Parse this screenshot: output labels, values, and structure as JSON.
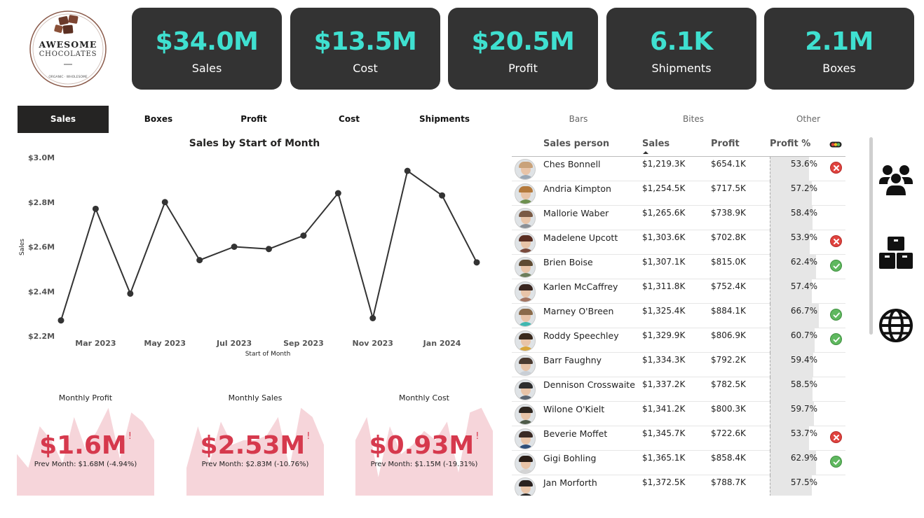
{
  "logo": {
    "line1": "AWESOME",
    "line2": "CHOCOLATES",
    "ring_text": "ORGANIC · WHOLESOME"
  },
  "kpis": [
    {
      "value": "$34.0M",
      "label": "Sales"
    },
    {
      "value": "$13.5M",
      "label": "Cost"
    },
    {
      "value": "$20.5M",
      "label": "Profit"
    },
    {
      "value": "6.1K",
      "label": "Shipments"
    },
    {
      "value": "2.1M",
      "label": "Boxes"
    }
  ],
  "metric_tabs": [
    "Sales",
    "Boxes",
    "Profit",
    "Cost",
    "Shipments"
  ],
  "active_metric_tab": "Sales",
  "product_tabs": [
    "Bars",
    "Bites",
    "Other"
  ],
  "chart_data": {
    "type": "line",
    "title": "Sales by Start of Month",
    "xlabel": "Start of Month",
    "ylabel": "Sales",
    "y_ticks": [
      "$2.2M",
      "$2.4M",
      "$2.6M",
      "$2.8M",
      "$3.0M"
    ],
    "x_ticks": [
      "Mar 2023",
      "May 2023",
      "Jul 2023",
      "Sep 2023",
      "Nov 2023",
      "Jan 2024"
    ],
    "ylim": [
      2.2,
      3.0
    ],
    "x": [
      "Feb 2023",
      "Mar 2023",
      "Apr 2023",
      "May 2023",
      "Jun 2023",
      "Jul 2023",
      "Aug 2023",
      "Sep 2023",
      "Oct 2023",
      "Nov 2023",
      "Dec 2023",
      "Jan 2024",
      "Feb 2024"
    ],
    "values": [
      2.27,
      2.77,
      2.39,
      2.8,
      2.54,
      2.6,
      2.59,
      2.65,
      2.84,
      2.28,
      2.94,
      2.83,
      2.53
    ],
    "color": "#333333"
  },
  "monthly_cards": [
    {
      "title": "Monthly Profit",
      "value": "$1.6M",
      "flag": "!",
      "prev": "Prev Month: $1.68M (-4.94%)",
      "spark": [
        0.45,
        0.3,
        0.75,
        0.6,
        0.35,
        0.85,
        0.5,
        0.7,
        0.95,
        0.4,
        0.9,
        0.8,
        0.6
      ]
    },
    {
      "title": "Monthly Sales",
      "value": "$2.53M",
      "flag": "!",
      "prev": "Prev Month: $2.83M (-10.76%)",
      "spark": [
        0.3,
        0.75,
        0.35,
        0.8,
        0.55,
        0.6,
        0.6,
        0.65,
        0.85,
        0.3,
        0.95,
        0.85,
        0.55
      ]
    },
    {
      "title": "Monthly Cost",
      "value": "$0.93M",
      "flag": "!",
      "prev": "Prev Month: $1.15M (-19.31%)",
      "spark": [
        0.6,
        0.85,
        0.2,
        0.75,
        0.45,
        0.55,
        0.7,
        0.6,
        0.8,
        0.25,
        0.9,
        0.95,
        0.7
      ]
    }
  ],
  "table": {
    "headers": {
      "person": "Sales person",
      "sales": "Sales",
      "profit": "Profit",
      "pct": "Profit %"
    },
    "rows": [
      {
        "name": "Ches Bonnell",
        "sales": "$1,219.3K",
        "profit": "$654.1K",
        "pct": "53.6%",
        "pct_value": 53.6,
        "status": "bad",
        "hair": "#c9a27a",
        "shirt": "#9aa7b5"
      },
      {
        "name": "Andria Kimpton",
        "sales": "$1,254.5K",
        "profit": "$717.5K",
        "pct": "57.2%",
        "pct_value": 57.2,
        "status": "none",
        "hair": "#b47a3d",
        "shirt": "#6c8f4e"
      },
      {
        "name": "Mallorie Waber",
        "sales": "$1,265.6K",
        "profit": "$738.9K",
        "pct": "58.4%",
        "pct_value": 58.4,
        "status": "none",
        "hair": "#7a5a45",
        "shirt": "#8a8f96"
      },
      {
        "name": "Madelene Upcott",
        "sales": "$1,303.6K",
        "profit": "$702.8K",
        "pct": "53.9%",
        "pct_value": 53.9,
        "status": "bad",
        "hair": "#5a2e22",
        "shirt": "#7a4a3c"
      },
      {
        "name": "Brien Boise",
        "sales": "$1,307.1K",
        "profit": "$815.0K",
        "pct": "62.4%",
        "pct_value": 62.4,
        "status": "good",
        "hair": "#5e4a32",
        "shirt": "#6b7d5a"
      },
      {
        "name": "Karlen McCaffrey",
        "sales": "$1,311.8K",
        "profit": "$752.4K",
        "pct": "57.4%",
        "pct_value": 57.4,
        "status": "none",
        "hair": "#3a2620",
        "shirt": "#a47460"
      },
      {
        "name": "Marney O'Breen",
        "sales": "$1,325.4K",
        "profit": "$884.1K",
        "pct": "66.7%",
        "pct_value": 66.7,
        "status": "good",
        "hair": "#8a6a4a",
        "shirt": "#3fb7b0"
      },
      {
        "name": "Roddy Speechley",
        "sales": "$1,329.9K",
        "profit": "$806.9K",
        "pct": "60.7%",
        "pct_value": 60.7,
        "status": "good",
        "hair": "#3a2a1e",
        "shirt": "#d9a63a"
      },
      {
        "name": "Barr Faughny",
        "sales": "$1,334.3K",
        "profit": "$792.2K",
        "pct": "59.4%",
        "pct_value": 59.4,
        "status": "none",
        "hair": "#4a3a30",
        "shirt": "#c9cfd6"
      },
      {
        "name": "Dennison Crosswaite",
        "sales": "$1,337.2K",
        "profit": "$782.5K",
        "pct": "58.5%",
        "pct_value": 58.5,
        "status": "none",
        "hair": "#2e2e2e",
        "shirt": "#5a6470"
      },
      {
        "name": "Wilone O'Kielt",
        "sales": "$1,341.2K",
        "profit": "$800.3K",
        "pct": "59.7%",
        "pct_value": 59.7,
        "status": "none",
        "hair": "#2e2620",
        "shirt": "#4d5a48"
      },
      {
        "name": "Beverie Moffet",
        "sales": "$1,345.7K",
        "profit": "$722.6K",
        "pct": "53.7%",
        "pct_value": 53.7,
        "status": "bad",
        "hair": "#3a2a24",
        "shirt": "#2f4f7a"
      },
      {
        "name": "Gigi Bohling",
        "sales": "$1,365.1K",
        "profit": "$858.4K",
        "pct": "62.9%",
        "pct_value": 62.9,
        "status": "good",
        "hair": "#2a1e18",
        "shirt": "#d4d4d4"
      },
      {
        "name": "Jan Morforth",
        "sales": "$1,372.5K",
        "profit": "$788.7K",
        "pct": "57.5%",
        "pct_value": 57.5,
        "status": "none",
        "hair": "#2a2220",
        "shirt": "#2a2a2a"
      }
    ]
  },
  "nav_icons": [
    "people-icon",
    "boxes-icon",
    "globe-icon"
  ],
  "colors": {
    "kpi_bg": "#333333",
    "kpi_value": "#3fe0d0",
    "negative": "#d6394d",
    "spark_fill": "#f6d5da"
  }
}
